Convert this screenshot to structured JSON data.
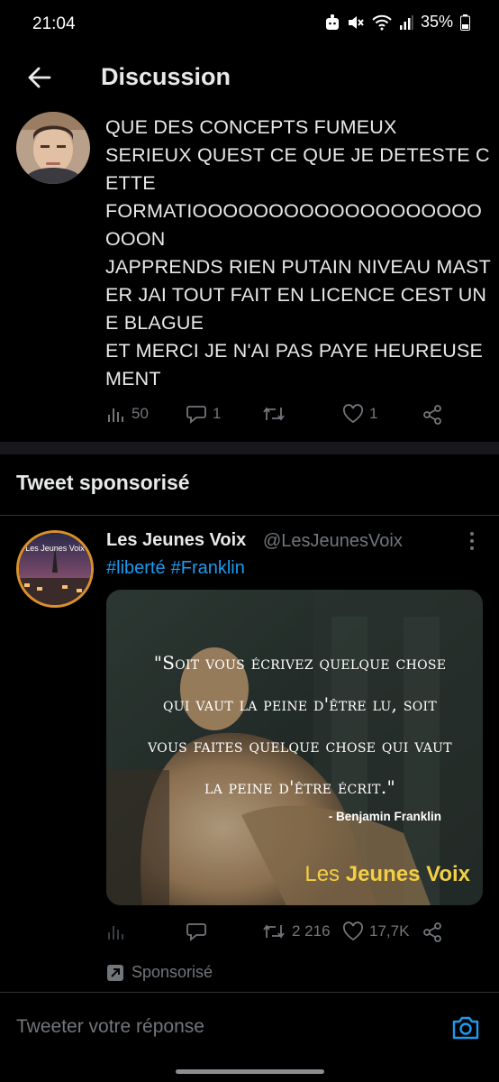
{
  "status_bar": {
    "time": "21:04",
    "battery": "35%",
    "icons": [
      "app-notification-icon",
      "mute-icon",
      "wifi-icon",
      "signal-icon",
      "battery-icon"
    ]
  },
  "header": {
    "title": "Discussion",
    "back_icon": "arrow-left-icon"
  },
  "reply_tweet": {
    "text": "QUE DES CONCEPTS FUMEUX\nSERIEUX QUEST CE QUE JE DETESTE CETTE\nFORMATIOOOOOOOOOOOOOOOOOOOOOON\nJAPPRENDS RIEN PUTAIN NIVEAU MASTER JAI TOUT FAIT EN LICENCE CEST UNE BLAGUE\nET MERCI JE N'AI PAS PAYE HEUREUSEMENT",
    "views": "50",
    "replies": "1",
    "retweets": "",
    "likes": "1"
  },
  "sponsored_section": {
    "title": "Tweet sponsorisé"
  },
  "promoted_tweet": {
    "name": "Les Jeunes Voix",
    "handle": "@LesJeunesVoix",
    "hashtags": [
      "#liberté",
      "#Franklin"
    ],
    "avatar_label": "Les Jeunes Voix",
    "image": {
      "quote": "\"Soit vous écrivez quelque chose qui vaut la peine d'être lu, soit vous faites quelque chose qui vaut la peine d'être écrit.\"",
      "author": "- Benjamin Franklin",
      "brand_prefix": "Les ",
      "brand_bold": "Jeunes Voix"
    },
    "retweets": "2 216",
    "likes": "17,7K",
    "promoted_label": "Sponsorisé"
  },
  "reply_bar": {
    "placeholder": "Tweeter votre réponse"
  },
  "colors": {
    "background": "#000000",
    "text": "#e7e9ea",
    "muted": "#71767b",
    "accent": "#1d9bf0",
    "brand_yellow": "#f3cf45"
  }
}
